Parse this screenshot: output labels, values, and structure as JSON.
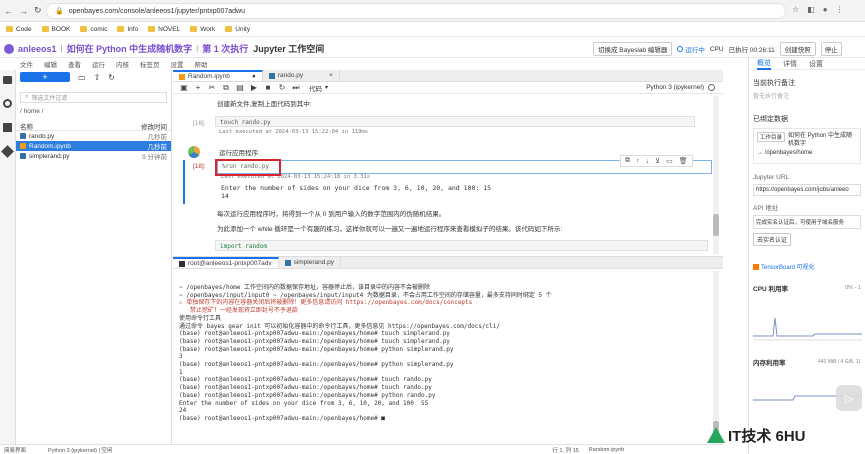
{
  "browser": {
    "url": "openbayes.com/console/anleeos1/jupyter/pntxp007adwu"
  },
  "bookmarks": [
    "Code",
    "BOOK",
    "comic",
    "Info",
    "NOVEL",
    "Work",
    "Unity"
  ],
  "appbar": {
    "user": "anleeos1",
    "title_parts": [
      "如何在 Python 中生成随机数字",
      "第 1 次执行",
      "Jupyter 工作空间"
    ],
    "switch_button": "切换成 Bayeslab 编辑器",
    "status": "运行中",
    "resource": "CPU",
    "elapsed": "已执行 00:26:11",
    "create_snapshot": "创建快照",
    "stop": "停止"
  },
  "menu": [
    "文件",
    "编辑",
    "查看",
    "运行",
    "内核",
    "标签页",
    "设置",
    "帮助"
  ],
  "filepanel": {
    "new_button": "+",
    "filter_placeholder": "筛选文件过滤",
    "path": "/ home /",
    "col_name": "名称",
    "col_modified": "修改时间",
    "files": [
      {
        "name": "rando.py",
        "modified": "几秒前",
        "selected": false
      },
      {
        "name": "Random.ipynb",
        "modified": "几秒前",
        "selected": true
      },
      {
        "name": "simplerand.py",
        "modified": "9 分钟前",
        "selected": false
      }
    ]
  },
  "notebook": {
    "tabs": [
      {
        "label": "Random.ipynb",
        "active": true
      },
      {
        "label": "rando.py",
        "active": false
      }
    ],
    "cell_type": "代码",
    "kernel": "Python 3 (ipykernel)",
    "top_text": "创建新文件,复制上面代码到其中:",
    "cell1_prompt": "[16]:",
    "cell1_code": "touch rando.py",
    "cell1_exec": "Last executed at 2024-03-13 15:22:04 in 119ms",
    "md_text": "运行应用程序:",
    "cell2_prompt": "[18]:",
    "cell2_code": "%run rando.py",
    "cell2_exec": "Last executed at 2024-03-13 15:24:18 in 3.31s",
    "cell2_output": [
      "Enter the number of sides on your dice from 3, 6, 10, 20, and 100:  15",
      "14"
    ],
    "para1": "每次运行应用程序时，将得到一个从 0 到用户输入的数字范围内的伪随机结果。",
    "para2": "为此添加一个 while 循环是一个有趣的练习，这样你就可以一遍又一遍地运行程序来查看模拟子的结果。该代码如下所示:",
    "cell3_code": "import random"
  },
  "terminal": {
    "tabs": [
      {
        "label": "root@anleeos1-pntxp007adv",
        "active": true
      },
      {
        "label": "simplerand.py",
        "active": false
      }
    ],
    "lines": [
      "~ /openbayes/home 工作空间内的数据保存地址，容器停止后，该目录中的内容不会被删除",
      "~ /openbayes/input/input0 ~ /openbayes/input/input4 为数据目录，不会占用工作空间的存储容量，最多支持同时绑定 5 个",
      "",
      "⚠ 单独保存下的内容在容器关闭后将被删除！更多信息请访问 https://openbayes.com/docs/concepts",
      "   禁止挖矿！一经发现将立即封号不予退款",
      "",
      "使用命令行工具",
      "",
      "通过命令 bayes gear init 可以初始化容器中的命令行工具，更多信息见 https://openbayes.com/docs/cli/",
      "",
      "(base) root@anleeos1-pntxp007adwu-main:/openbayes/home# touch simplerand.py",
      "(base) root@anleeos1-pntxp007adwu-main:/openbayes/home# touch simplerand.py",
      "(base) root@anleeos1-pntxp007adwu-main:/openbayes/home# python simplerand.py",
      "3",
      "(base) root@anleeos1-pntxp007adwu-main:/openbayes/home# python simplerand.py",
      "1",
      "(base) root@anleeos1-pntxp007adwu-main:/openbayes/home# touch rando.py",
      "(base) root@anleeos1-pntxp007adwu-main:/openbayes/home# touch rando.py",
      "(base) root@anleeos1-pntxp007adwu-main:/openbayes/home# python rando.py",
      "Enter the number of sides on your dice from 3, 6, 10, 20, and 100  55",
      "24",
      "(base) root@anleeos1-pntxp007adwu-main:/openbayes/home# ■"
    ]
  },
  "rightpanel": {
    "tabs": [
      "概览",
      "详情",
      "设置"
    ],
    "current_note_label": "当前执行备注",
    "current_note_hint": "暂无执行备注",
    "bound_label": "已绑定数据",
    "bound_tag": "工作目录",
    "bound_name": "如何在 Python 中生成随机数字",
    "bound_path": "→ /openbayes/home",
    "jupyter_url_label": "Jupyter URL",
    "jupyter_url": "https://openbayes.com/jobs/anleeo",
    "api_label": "API 地址",
    "api_hint": "完成实名认证后，可使用子域名服务",
    "api_button": "去实名认证",
    "tensorboard": "TensorBoard 可视化",
    "cpu_label": "CPU 利用率",
    "cpu_value": "0% - 1",
    "mem_label": "内存利用率",
    "mem_value": "440 MiB / 4 GiB, 11"
  },
  "status": {
    "mode": "简易界面",
    "kernel": "Python 3 (ipykernel) | 空闲",
    "position": "行 1, 列 15",
    "file": "Random.ipynb"
  },
  "watermark": "IT技术 6HU"
}
